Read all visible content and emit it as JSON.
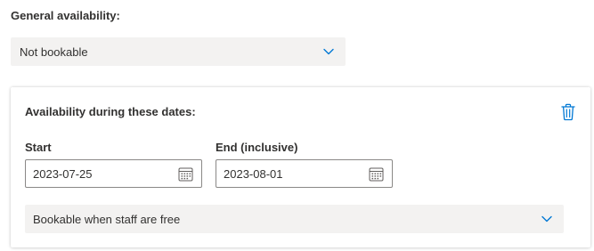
{
  "general": {
    "label": "General availability:",
    "dropdown_value": "Not bookable"
  },
  "card": {
    "title": "Availability during these dates:",
    "start_label": "Start",
    "start_value": "2023-07-25",
    "end_label": "End (inclusive)",
    "end_value": "2023-08-01",
    "mode_value": "Bookable when staff are free"
  },
  "icons": {
    "chevron": "chevron-down-icon",
    "calendar": "calendar-icon",
    "delete": "trash-icon"
  },
  "colors": {
    "accent": "#0078d4",
    "dropdown_bg": "#f3f2f1",
    "text": "#323130",
    "input_border": "#8a8886"
  }
}
